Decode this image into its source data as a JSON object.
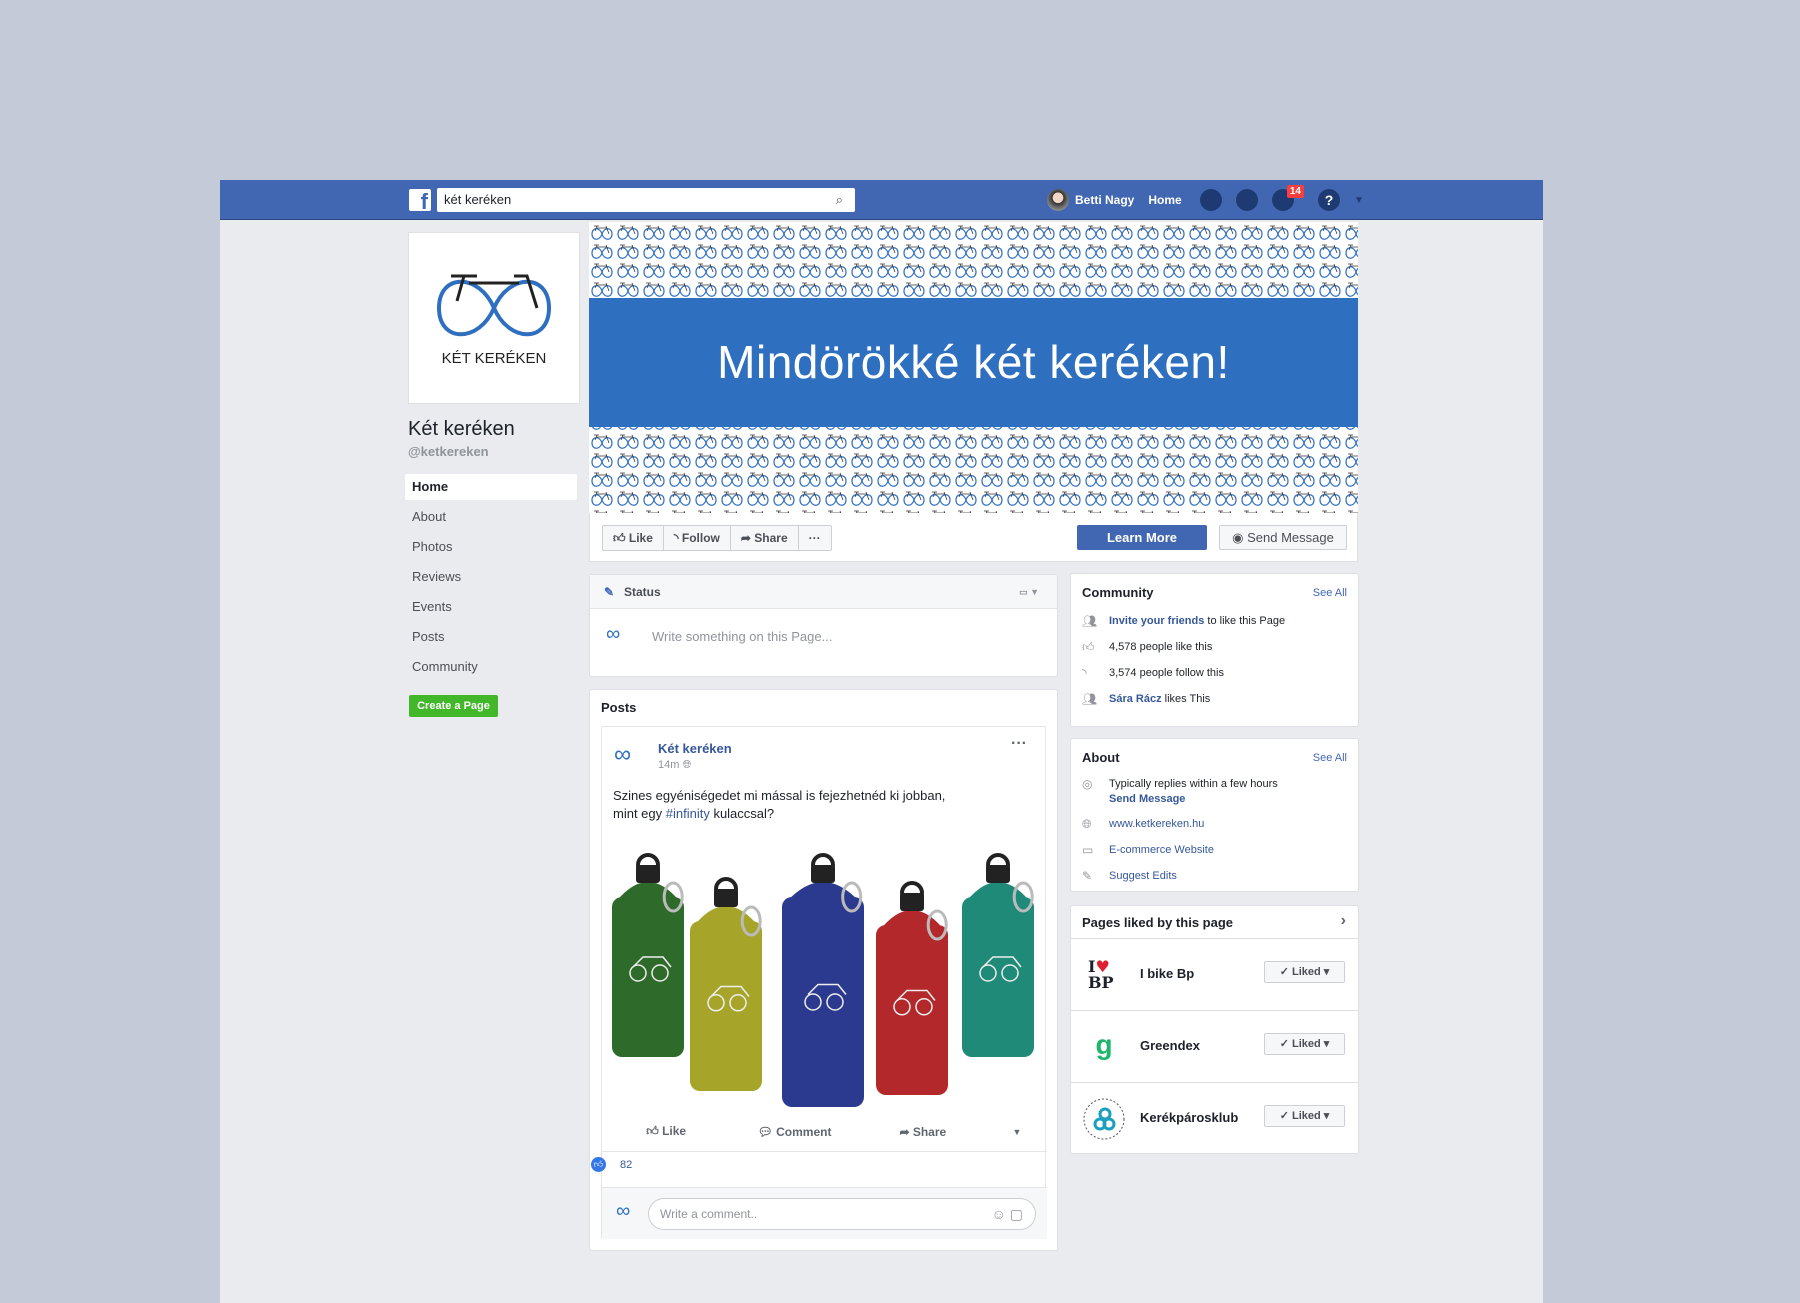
{
  "topbar": {
    "search_value": "két keréken",
    "user_name": "Betti Nagy",
    "home_label": "Home",
    "notifications_count": "14"
  },
  "page": {
    "name": "Két keréken",
    "handle": "@ketkereken",
    "logo_text": "KÉT KERÉKEN",
    "cover_slogan": "Mindörökké két keréken!"
  },
  "nav": {
    "items": [
      "Home",
      "About",
      "Photos",
      "Reviews",
      "Events",
      "Posts",
      "Community"
    ],
    "create_page": "Create a Page"
  },
  "actions": {
    "like": "Like",
    "follow": "Follow",
    "share": "Share",
    "more": "···",
    "learn_more": "Learn More",
    "send_message": "Send Message"
  },
  "status": {
    "title": "Status",
    "placeholder": "Write something on this Page..."
  },
  "posts": {
    "title": "Posts",
    "author": "Két keréken",
    "time": "14m",
    "text_line1": "Szines egyéniségedet mi mással is fejezhetnéd ki jobban,",
    "text_line2_pre": "mint egy ",
    "hashtag": "#infinity",
    "text_line2_post": " kulaccsal?",
    "like": "Like",
    "comment": "Comment",
    "share": "Share",
    "likes_count": "82",
    "comment_placeholder": "Write a comment.."
  },
  "community": {
    "title": "Community",
    "see_all": "See All",
    "invite_link": "Invite your friends",
    "invite_rest": " to like this Page",
    "likes": "4,578 people like this",
    "follows": "3,574 people follow this",
    "friend": "Sára Rácz",
    "friend_rest": " likes This"
  },
  "about": {
    "title": "About",
    "see_all": "See All",
    "replies": "Typically replies within a few hours",
    "send_message": "Send Message",
    "website": "www.ketkereken.hu",
    "category": "E-commerce Website",
    "suggest": "Suggest Edits"
  },
  "liked_pages": {
    "title": "Pages liked by this page",
    "liked_label": "✓ Liked ▾",
    "items": [
      {
        "name": "I bike Bp"
      },
      {
        "name": "Greendex"
      },
      {
        "name": "Kerékpárosklub"
      }
    ]
  },
  "colors": {
    "brand": "#4267b2",
    "cover_blue": "#2f6fc0",
    "create_green": "#42b72a",
    "bottles": [
      "#2e6b2a",
      "#a6a52a",
      "#2b3a8f",
      "#b3282b",
      "#1f8a78"
    ]
  }
}
